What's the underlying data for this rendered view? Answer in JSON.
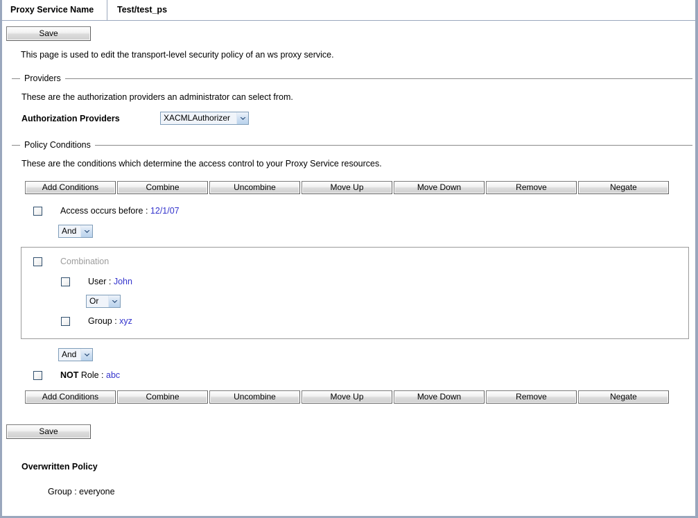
{
  "header": {
    "label": "Proxy Service Name",
    "value": "Test/test_ps"
  },
  "save_top": {
    "label": "Save"
  },
  "intro": "This page is used to edit the transport-level security policy of an ws proxy service.",
  "providers": {
    "legend": "Providers",
    "description": "These are the authorization providers an administrator can select from.",
    "field_label": "Authorization Providers",
    "selected": "XACMLAuthorizer"
  },
  "policy_conditions": {
    "legend": "Policy Conditions",
    "description": "These are the conditions which determine the access control to your Proxy Service resources.",
    "toolbar": [
      {
        "label": "Add Conditions"
      },
      {
        "label": "Combine"
      },
      {
        "label": "Uncombine"
      },
      {
        "label": "Move Up"
      },
      {
        "label": "Move Down"
      },
      {
        "label": "Remove"
      },
      {
        "label": "Negate"
      }
    ],
    "rows": {
      "access_before": {
        "prefix": "Access occurs before : ",
        "value": "12/1/07"
      },
      "logic_1": "And",
      "combination_label": "Combination",
      "user": {
        "prefix": "User : ",
        "value": "John"
      },
      "logic_2": "Or",
      "group": {
        "prefix": "Group : ",
        "value": "xyz"
      },
      "logic_3": "And",
      "role": {
        "negation": "NOT",
        "prefix": " Role : ",
        "value": "abc"
      }
    }
  },
  "save_bottom": {
    "label": "Save"
  },
  "overwritten": {
    "title": "Overwritten Policy",
    "items": [
      "Group : everyone"
    ]
  }
}
